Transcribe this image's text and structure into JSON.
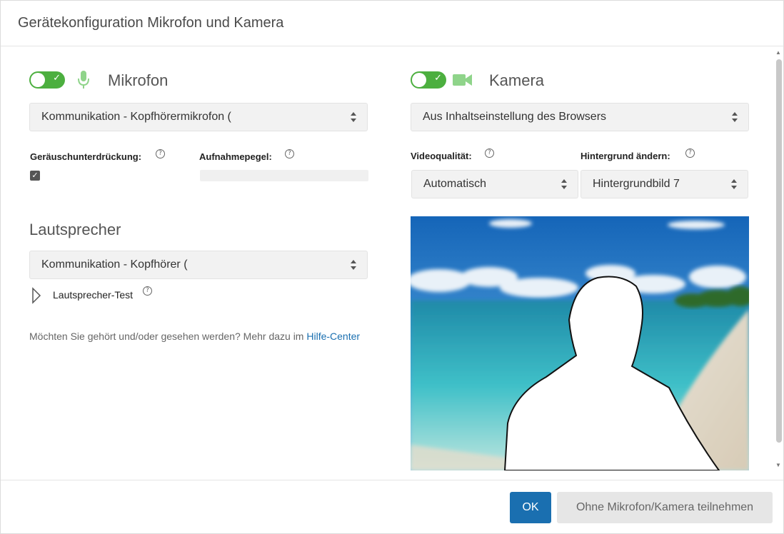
{
  "dialog": {
    "title": "Gerätekonfiguration Mikrofon und Kamera"
  },
  "microphone": {
    "enabled": true,
    "icon": "microphone-icon",
    "title": "Mikrofon",
    "device": "Kommunikation - Kopfhörermikrofon (",
    "noise_suppression_label": "Geräuschunterdrückung:",
    "noise_suppression_checked": true,
    "recording_level_label": "Aufnahmepegel:",
    "recording_level": 0
  },
  "speaker": {
    "title": "Lautsprecher",
    "device": "Kommunikation - Kopfhörer (",
    "test_label": "Lautsprecher-Test"
  },
  "info": {
    "text": "Möchten Sie gehört und/oder gesehen werden? Mehr dazu im ",
    "link": "Hilfe-Center"
  },
  "camera": {
    "enabled": true,
    "icon": "video-camera-icon",
    "title": "Kamera",
    "device": "Aus Inhaltseinstellung des Browsers",
    "video_quality_label": "Videoqualität:",
    "video_quality": "Automatisch",
    "background_label": "Hintergrund ändern:",
    "background": "Hintergrundbild 7"
  },
  "footer": {
    "ok_label": "OK",
    "skip_label": "Ohne Mikrofon/Kamera teilnehmen"
  },
  "colors": {
    "accent": "#1a6fb0",
    "toggle_on": "#4caf3f",
    "icon_green": "#8fd48a"
  }
}
